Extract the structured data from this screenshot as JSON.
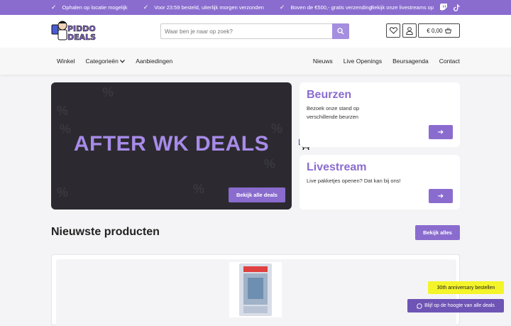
{
  "topbar": {
    "usps": [
      "Ophalen op locatie mogelijk",
      "Voor 23:59 besteld, uiterlijk morgen verzonden",
      "Boven de €500,- gratis verzending"
    ],
    "livestream_text": "Bekijk onze livestreams op"
  },
  "header": {
    "logo_text_line1": "PIDDO",
    "logo_text_line2": "DEALS",
    "search_placeholder": "Waar ben je naar op zoek?",
    "cart_total": "€ 0,00"
  },
  "nav": {
    "left": [
      "Winkel",
      "Categorieën",
      "Aanbiedingen"
    ],
    "right": [
      "Nieuws",
      "Live Openings",
      "Beursagenda",
      "Contact"
    ]
  },
  "hero": {
    "title": "AFTER WK DEALS",
    "button": "Bekijk alle deals"
  },
  "cards": {
    "beurzen": {
      "title": "Beurzen",
      "text_line1": "Bezoek onze stand op",
      "text_line2": "verschillende beurzen"
    },
    "livestream": {
      "title": "Livestream",
      "text": "Live pakketjes openen? Dat kan bij ons!"
    }
  },
  "products": {
    "title": "Nieuwste producten",
    "button": "Bekijk alles"
  },
  "floating": {
    "anniversary": "30th anniversary bestellen",
    "whatsapp": "Blijf op de hoogte van alle deals"
  },
  "colors": {
    "brand": "#8a6ccf",
    "hero_bg": "#2c2a30",
    "anniversary_bg": "#f4f42a"
  }
}
